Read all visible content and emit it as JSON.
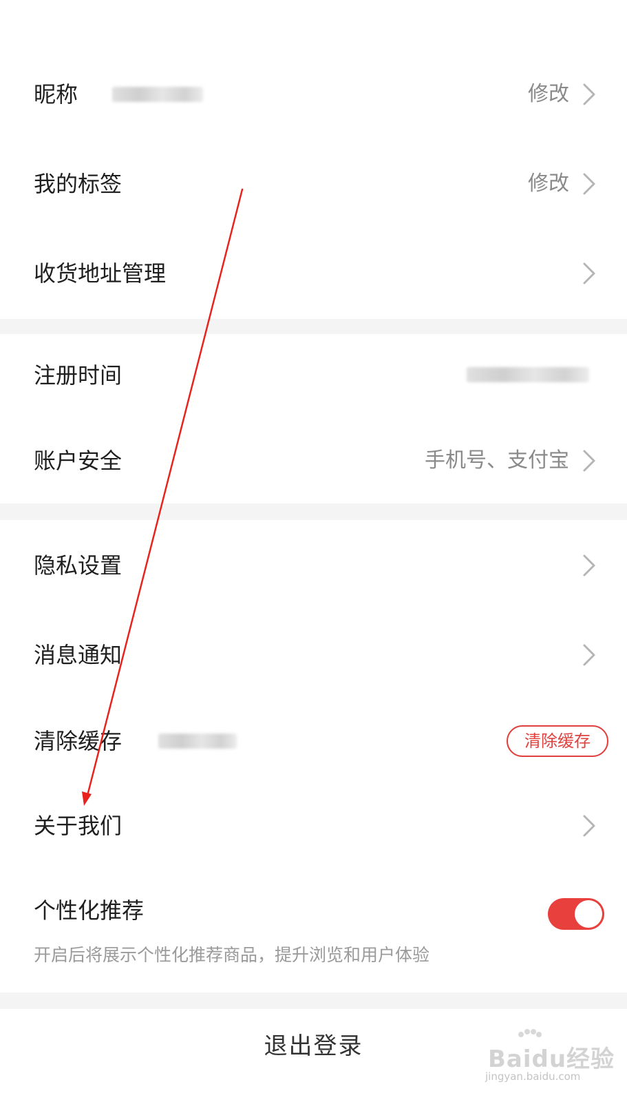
{
  "profile": {
    "nickname": {
      "label": "昵称",
      "action": "修改"
    },
    "tags": {
      "label": "我的标签",
      "action": "修改"
    },
    "address": {
      "label": "收货地址管理"
    }
  },
  "account": {
    "register_time": {
      "label": "注册时间"
    },
    "security": {
      "label": "账户安全",
      "value": "手机号、支付宝"
    }
  },
  "settings": {
    "privacy": {
      "label": "隐私设置"
    },
    "notifications": {
      "label": "消息通知"
    },
    "cache": {
      "label": "清除缓存",
      "button": "清除缓存"
    },
    "about": {
      "label": "关于我们"
    },
    "personalized": {
      "label": "个性化推荐",
      "description": "开启后将展示个性化推荐商品，提升浏览和用户体验",
      "enabled": true
    }
  },
  "logout": {
    "label": "退出登录"
  },
  "watermark": {
    "brand": "Baidu经验",
    "url": "jingyan.baidu.com"
  },
  "colors": {
    "accent": "#e8413d",
    "annotation_arrow": "#e8231e",
    "separator": "#f4f4f4",
    "secondary_text": "#8a8a8a"
  }
}
